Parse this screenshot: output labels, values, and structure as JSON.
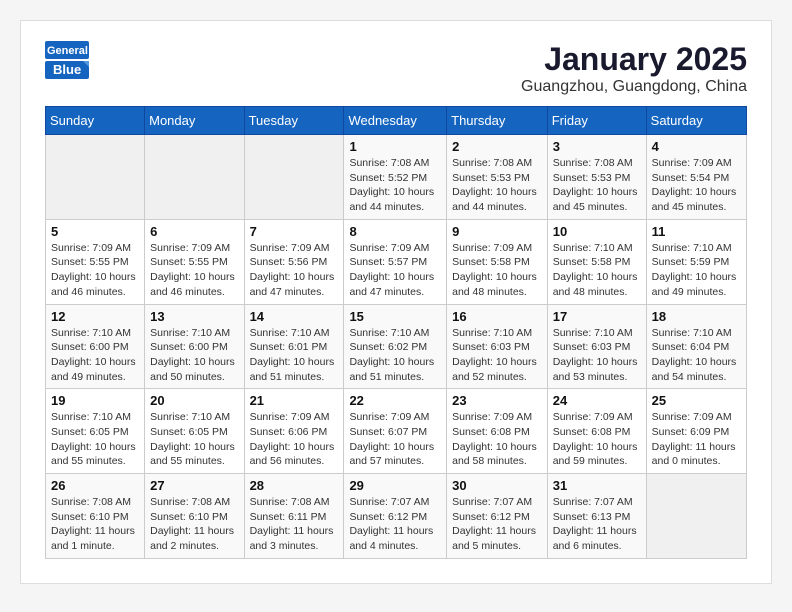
{
  "header": {
    "logo_general": "General",
    "logo_blue": "Blue",
    "month_title": "January 2025",
    "location": "Guangzhou, Guangdong, China"
  },
  "weekdays": [
    "Sunday",
    "Monday",
    "Tuesday",
    "Wednesday",
    "Thursday",
    "Friday",
    "Saturday"
  ],
  "weeks": [
    [
      {
        "day": "",
        "info": ""
      },
      {
        "day": "",
        "info": ""
      },
      {
        "day": "",
        "info": ""
      },
      {
        "day": "1",
        "info": "Sunrise: 7:08 AM\nSunset: 5:52 PM\nDaylight: 10 hours\nand 44 minutes."
      },
      {
        "day": "2",
        "info": "Sunrise: 7:08 AM\nSunset: 5:53 PM\nDaylight: 10 hours\nand 44 minutes."
      },
      {
        "day": "3",
        "info": "Sunrise: 7:08 AM\nSunset: 5:53 PM\nDaylight: 10 hours\nand 45 minutes."
      },
      {
        "day": "4",
        "info": "Sunrise: 7:09 AM\nSunset: 5:54 PM\nDaylight: 10 hours\nand 45 minutes."
      }
    ],
    [
      {
        "day": "5",
        "info": "Sunrise: 7:09 AM\nSunset: 5:55 PM\nDaylight: 10 hours\nand 46 minutes."
      },
      {
        "day": "6",
        "info": "Sunrise: 7:09 AM\nSunset: 5:55 PM\nDaylight: 10 hours\nand 46 minutes."
      },
      {
        "day": "7",
        "info": "Sunrise: 7:09 AM\nSunset: 5:56 PM\nDaylight: 10 hours\nand 47 minutes."
      },
      {
        "day": "8",
        "info": "Sunrise: 7:09 AM\nSunset: 5:57 PM\nDaylight: 10 hours\nand 47 minutes."
      },
      {
        "day": "9",
        "info": "Sunrise: 7:09 AM\nSunset: 5:58 PM\nDaylight: 10 hours\nand 48 minutes."
      },
      {
        "day": "10",
        "info": "Sunrise: 7:10 AM\nSunset: 5:58 PM\nDaylight: 10 hours\nand 48 minutes."
      },
      {
        "day": "11",
        "info": "Sunrise: 7:10 AM\nSunset: 5:59 PM\nDaylight: 10 hours\nand 49 minutes."
      }
    ],
    [
      {
        "day": "12",
        "info": "Sunrise: 7:10 AM\nSunset: 6:00 PM\nDaylight: 10 hours\nand 49 minutes."
      },
      {
        "day": "13",
        "info": "Sunrise: 7:10 AM\nSunset: 6:00 PM\nDaylight: 10 hours\nand 50 minutes."
      },
      {
        "day": "14",
        "info": "Sunrise: 7:10 AM\nSunset: 6:01 PM\nDaylight: 10 hours\nand 51 minutes."
      },
      {
        "day": "15",
        "info": "Sunrise: 7:10 AM\nSunset: 6:02 PM\nDaylight: 10 hours\nand 51 minutes."
      },
      {
        "day": "16",
        "info": "Sunrise: 7:10 AM\nSunset: 6:03 PM\nDaylight: 10 hours\nand 52 minutes."
      },
      {
        "day": "17",
        "info": "Sunrise: 7:10 AM\nSunset: 6:03 PM\nDaylight: 10 hours\nand 53 minutes."
      },
      {
        "day": "18",
        "info": "Sunrise: 7:10 AM\nSunset: 6:04 PM\nDaylight: 10 hours\nand 54 minutes."
      }
    ],
    [
      {
        "day": "19",
        "info": "Sunrise: 7:10 AM\nSunset: 6:05 PM\nDaylight: 10 hours\nand 55 minutes."
      },
      {
        "day": "20",
        "info": "Sunrise: 7:10 AM\nSunset: 6:05 PM\nDaylight: 10 hours\nand 55 minutes."
      },
      {
        "day": "21",
        "info": "Sunrise: 7:09 AM\nSunset: 6:06 PM\nDaylight: 10 hours\nand 56 minutes."
      },
      {
        "day": "22",
        "info": "Sunrise: 7:09 AM\nSunset: 6:07 PM\nDaylight: 10 hours\nand 57 minutes."
      },
      {
        "day": "23",
        "info": "Sunrise: 7:09 AM\nSunset: 6:08 PM\nDaylight: 10 hours\nand 58 minutes."
      },
      {
        "day": "24",
        "info": "Sunrise: 7:09 AM\nSunset: 6:08 PM\nDaylight: 10 hours\nand 59 minutes."
      },
      {
        "day": "25",
        "info": "Sunrise: 7:09 AM\nSunset: 6:09 PM\nDaylight: 11 hours\nand 0 minutes."
      }
    ],
    [
      {
        "day": "26",
        "info": "Sunrise: 7:08 AM\nSunset: 6:10 PM\nDaylight: 11 hours\nand 1 minute."
      },
      {
        "day": "27",
        "info": "Sunrise: 7:08 AM\nSunset: 6:10 PM\nDaylight: 11 hours\nand 2 minutes."
      },
      {
        "day": "28",
        "info": "Sunrise: 7:08 AM\nSunset: 6:11 PM\nDaylight: 11 hours\nand 3 minutes."
      },
      {
        "day": "29",
        "info": "Sunrise: 7:07 AM\nSunset: 6:12 PM\nDaylight: 11 hours\nand 4 minutes."
      },
      {
        "day": "30",
        "info": "Sunrise: 7:07 AM\nSunset: 6:12 PM\nDaylight: 11 hours\nand 5 minutes."
      },
      {
        "day": "31",
        "info": "Sunrise: 7:07 AM\nSunset: 6:13 PM\nDaylight: 11 hours\nand 6 minutes."
      },
      {
        "day": "",
        "info": ""
      }
    ]
  ]
}
